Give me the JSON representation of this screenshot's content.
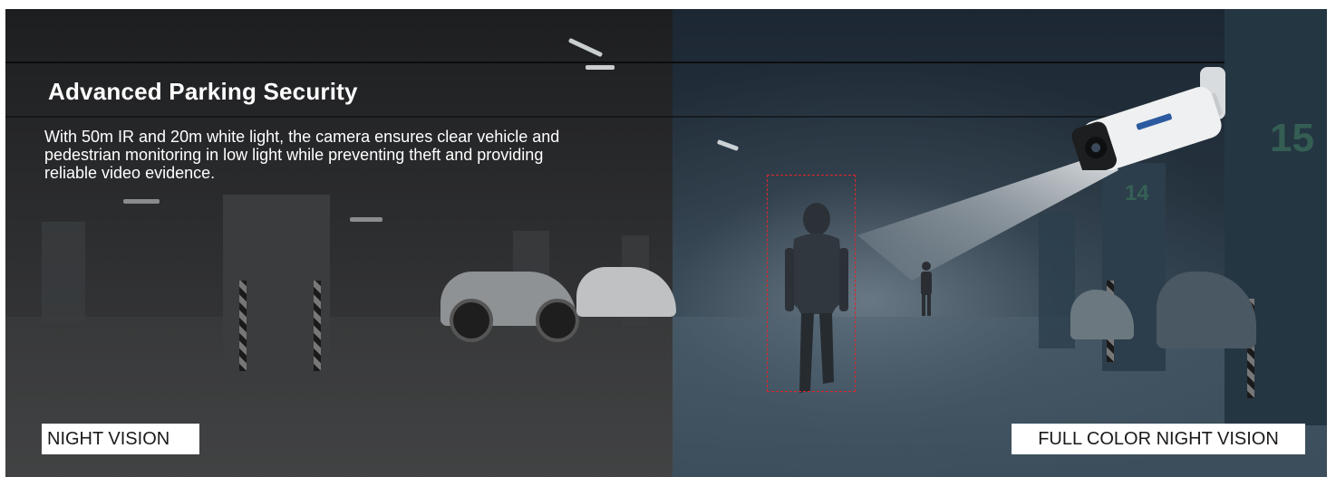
{
  "banner": {
    "title": "Advanced Parking Security",
    "description": "With 50m IR and 20m white light, the camera ensures clear vehicle and pedestrian monitoring in low light while preventing theft and providing reliable video evidence.",
    "label_left": "NIGHT VISION",
    "label_right": "FULL COLOR NIGHT VISION",
    "icons": [
      "security-camera-icon",
      "person-silhouette-icon",
      "parked-car-icon"
    ],
    "colors": {
      "detection_box": "#e0242b",
      "label_bg": "#ffffff",
      "text": "#ffffff"
    }
  }
}
